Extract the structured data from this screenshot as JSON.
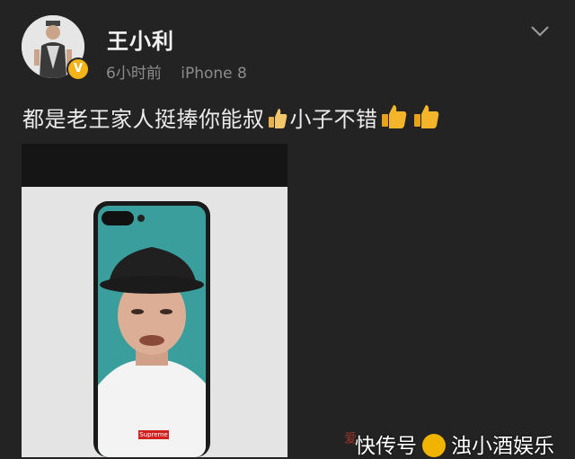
{
  "post": {
    "username": "王小利",
    "time": "6小时前",
    "device": "iPhone 8",
    "text_part1": "都是老王家人挺捧你能叔",
    "text_part2": "小子不错",
    "verified_mark": "V"
  },
  "image": {
    "phone_case_label": "Supreme"
  },
  "watermark": {
    "text_left": "快传号",
    "text_right": "浊小酒娱乐",
    "faint_prefix": "爱"
  },
  "colors": {
    "background": "#232323",
    "verified_badge": "#f5b31a",
    "phone_screen": "#3a9e9c"
  },
  "icons": {
    "more": "chevron-down-icon",
    "thumb": "thumbs-up-icon"
  }
}
